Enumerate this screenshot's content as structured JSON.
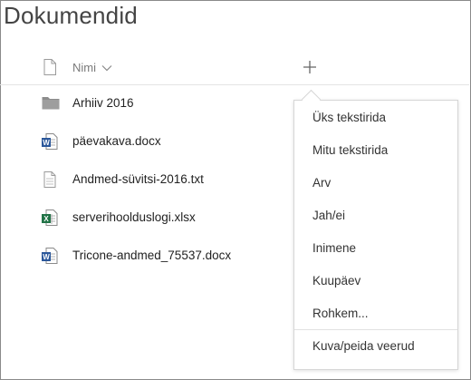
{
  "page": {
    "title": "Dokumendid"
  },
  "header": {
    "name_column_label": "Nimi"
  },
  "files": [
    {
      "name": "Arhiiv 2016",
      "icon": "folder-icon"
    },
    {
      "name": "päevakava.docx",
      "icon": "word-doc-icon"
    },
    {
      "name": "Andmed-süvitsi-2016.txt",
      "icon": "text-file-icon"
    },
    {
      "name": "serverihoolduslogi.xlsx",
      "icon": "excel-doc-icon"
    },
    {
      "name": "Tricone-andmed_75537.docx",
      "icon": "word-doc-icon"
    }
  ],
  "add_column_menu": {
    "items": [
      {
        "label": "Üks tekstirida"
      },
      {
        "label": "Mitu tekstirida"
      },
      {
        "label": "Arv"
      },
      {
        "label": "Jah/ei"
      },
      {
        "label": "Inimene"
      },
      {
        "label": "Kuupäev"
      },
      {
        "label": "Rohkem..."
      }
    ],
    "footer_item": {
      "label": "Kuva/peida veerud"
    }
  },
  "colors": {
    "word": "#2b579a",
    "excel": "#217346",
    "folder": "#8c8c8c",
    "border": "#8a8a8a"
  }
}
